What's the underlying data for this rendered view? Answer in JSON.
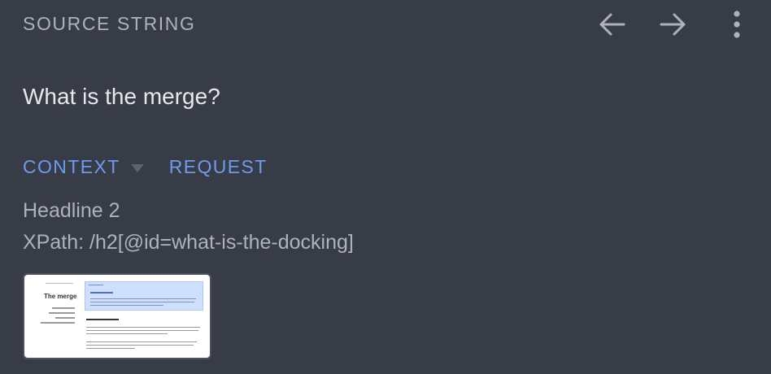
{
  "panel": {
    "heading": "SOURCE STRING",
    "toolbar": {
      "prev_icon": "arrow-left-icon",
      "next_icon": "arrow-right-icon",
      "more_icon": "more-vertical-icon"
    },
    "source_text": "What is the merge?",
    "tabs": [
      {
        "label": "CONTEXT",
        "has_dropdown": true
      },
      {
        "label": "REQUEST",
        "has_dropdown": false
      }
    ],
    "context": {
      "element_type": "Headline 2",
      "xpath": "XPath: /h2[@id=what-is-the-docking]"
    },
    "screenshot_thumbnail": {
      "page_title": "The merge",
      "section_heading": "What is the merge?"
    }
  },
  "colors": {
    "background": "#383c47",
    "heading": "#aeb2b9",
    "primary_text": "#e6e8eb",
    "accent": "#6d9bf0"
  }
}
